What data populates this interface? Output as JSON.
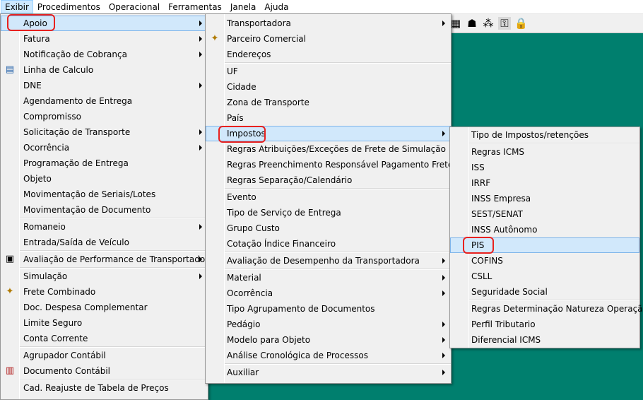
{
  "menubar": {
    "items": [
      "Exibir",
      "Procedimentos",
      "Operacional",
      "Ferramentas",
      "Janela",
      "Ajuda"
    ]
  },
  "toolbar": {
    "icons": [
      "calculator-icon",
      "person-icon",
      "people-icon",
      "key-icon",
      "lock-icon"
    ]
  },
  "menu_exibir": {
    "items": [
      "Apoio",
      "Fatura",
      "Notificação de Cobrança",
      "Linha de Calculo",
      "DNE",
      "Agendamento de Entrega",
      "Compromisso",
      "Solicitação de Transporte",
      "Ocorrência",
      "Programação de Entrega",
      "Objeto",
      "Movimentação de Seriais/Lotes",
      "Movimentação de Documento",
      "Romaneio",
      "Entrada/Saída de Veículo",
      "Avaliação de Performance de Transportadora",
      "Simulação",
      "Frete Combinado",
      "Doc. Despesa Complementar",
      "Limite Seguro",
      "Conta Corrente",
      "Agrupador Contábil",
      "Documento Contábil",
      "Cad. Reajuste de Tabela de Preços"
    ]
  },
  "menu_apoio": {
    "items": [
      "Transportadora",
      "Parceiro Comercial",
      "Endereços",
      "UF",
      "Cidade",
      "Zona de Transporte",
      "País",
      "Impostos",
      "Regras Atribuições/Exceções de Frete de Simulação",
      "Regras Preenchimento Responsável Pagamento Frete ST",
      "Regras Separação/Calendário",
      "Evento",
      "Tipo de Serviço de Entrega",
      "Grupo Custo",
      "Cotação Índice Financeiro",
      "Avaliação de Desempenho da Transportadora",
      "Material",
      "Ocorrência",
      "Tipo Agrupamento de Documentos",
      "Pedágio",
      "Modelo para Objeto",
      "Análise Cronológica de Processos",
      "Auxiliar"
    ]
  },
  "menu_impostos": {
    "items": [
      "Tipo de Impostos/retenções",
      "Regras ICMS",
      "ISS",
      "IRRF",
      "INSS Empresa",
      "SEST/SENAT",
      "INSS Autônomo",
      "PIS",
      "COFINS",
      "CSLL",
      "Seguridade Social",
      "Regras Determinação Natureza Operação",
      "Perfil Tributario",
      "Diferencial ICMS"
    ]
  },
  "colors": {
    "desktop": "#007f6e",
    "highlight": "#d1e8fb",
    "annotation": "#e8211f"
  }
}
